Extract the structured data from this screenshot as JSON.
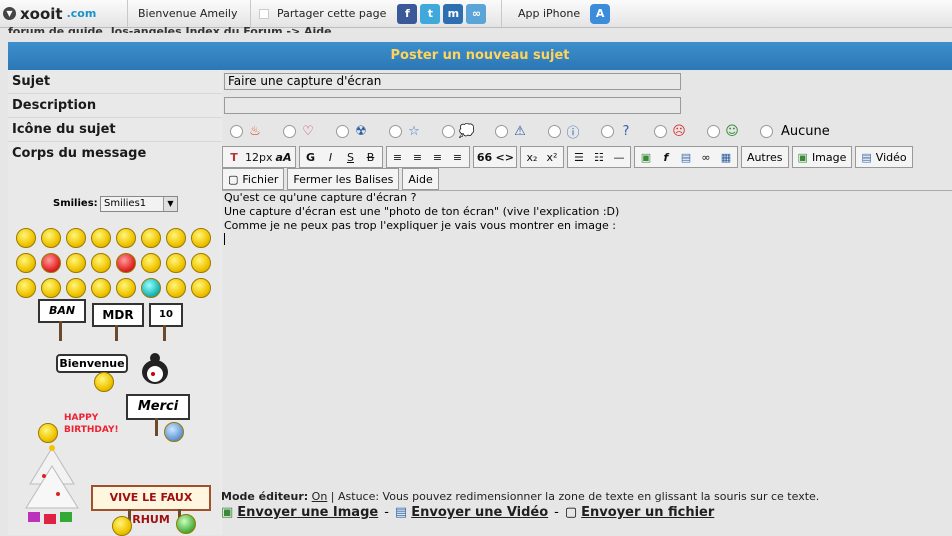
{
  "topbar": {
    "logo_text": "xooit",
    "logo_domain": ".com",
    "welcome": "Bienvenue Ameily",
    "share_label": "Partager cette page",
    "app_label": "App iPhone",
    "share_icons": [
      "facebook-icon",
      "twitter-icon",
      "myspace-icon",
      "delicious-icon"
    ]
  },
  "breadcrumb": "forum de guide, los-angeles    Index du Forum -> Aide",
  "form": {
    "header": "Poster un nouveau sujet",
    "subject_label": "Sujet",
    "subject_value": "Faire une capture d'écran",
    "description_label": "Description",
    "description_value": "",
    "icon_label": "Icône du sujet",
    "icon_none_label": "Aucune",
    "body_label": "Corps du message",
    "body_lines": [
      "Qu'est ce qu'une capture d'écran ?",
      "Une capture d'écran est une \"photo de ton écran\" (vive l'explication :D)",
      "Comme je ne peux pas trop l'expliquer je vais vous montrer en image :"
    ]
  },
  "toolbar": {
    "font_size": "12px",
    "font_size_icon": "aA",
    "bold": "G",
    "italic": "I",
    "underline": "S",
    "strike": "B",
    "quote": "66",
    "code": "<>",
    "sub": "x₂",
    "sup": "x²",
    "autres": "Autres",
    "image": "Image",
    "video": "Vidéo",
    "fichier": "Fichier",
    "fermer": "Fermer les Balises",
    "aide": "Aide"
  },
  "smilies": {
    "label": "Smilies:",
    "selected": "Smilies1",
    "signs": {
      "ban": "BAN",
      "mdr": "MDR",
      "ten": "10",
      "bienvenue": "Bienvenue",
      "merci": "Merci",
      "happy_birthday": "HAPPY BIRTHDAY!",
      "vive": "VIVE LE FAUX RHUM"
    }
  },
  "footer": {
    "mode_label": "Mode éditeur:",
    "mode_value": "On",
    "tip": " | Astuce: Vous pouvez redimensionner la zone de texte en glissant la souris sur ce texte.",
    "send_image": "Envoyer une Image",
    "send_video": "Envoyer une Vidéo",
    "send_file": "Envoyer un fichier",
    "sep": "-"
  },
  "colors": {
    "header_bg": "#3088c8",
    "header_text": "#ffd35c",
    "smiley": "#f0c400"
  }
}
